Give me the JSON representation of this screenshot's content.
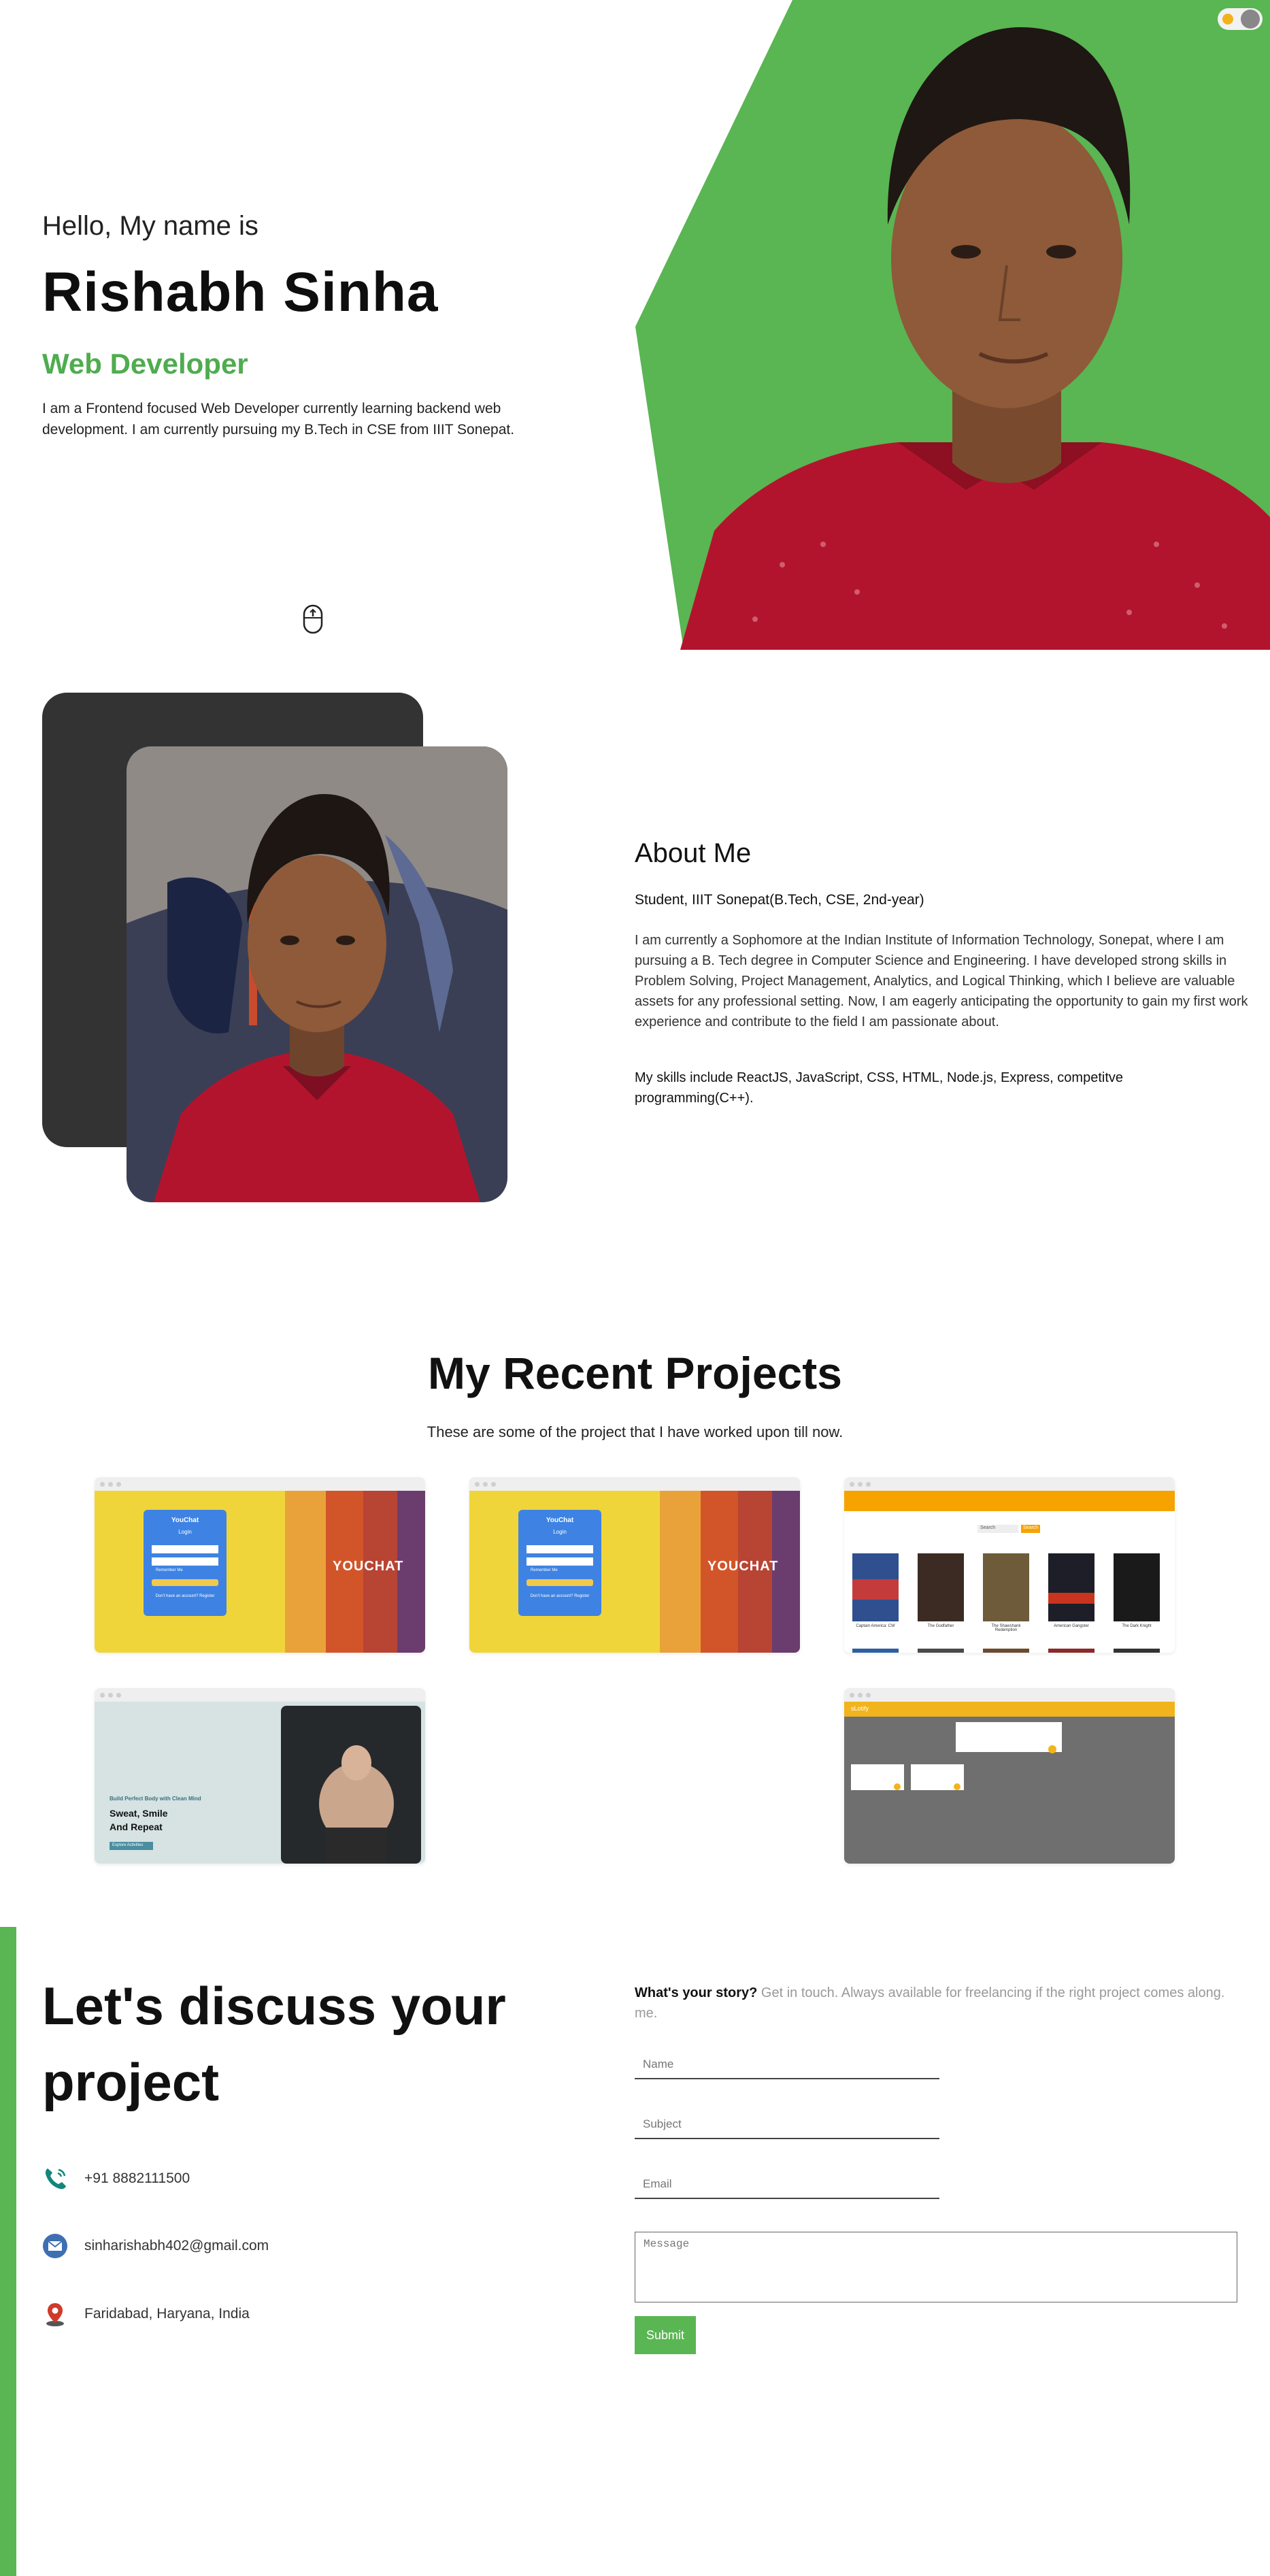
{
  "theme": {
    "accent": "#5ab553",
    "accent_text": "#4fac4f",
    "dark_card": "#333333"
  },
  "hero": {
    "greeting": "Hello, My name is",
    "name": "Rishabh Sinha",
    "role": "Web Developer",
    "bio": "I am a Frontend focused Web Developer currently learning backend web development. I am currently pursuing my B.Tech in CSE from IIIT Sonepat.",
    "photo_icon": "profile-photo",
    "scroll_icon": "mouse-scroll-icon",
    "theme_toggle_icon": "sun-moon-toggle-icon"
  },
  "about": {
    "title": "About Me",
    "subtitle": "Student, IIIT Sonepat(B.Tech, CSE, 2nd-year)",
    "paragraph": "I am currently a Sophomore at the Indian Institute of Information Technology, Sonepat, where I am pursuing a B. Tech degree in Computer Science and Engineering. I have developed strong skills in Problem Solving, Project Management, Analytics, and Logical Thinking, which I believe are valuable assets for any professional setting. Now, I am eagerly anticipating the opportunity to gain my first work experience and contribute to the field I am passionate about.",
    "skills": "My skills include ReactJS, JavaScript, CSS, HTML, Node.js, Express, competitve programming(C++)."
  },
  "projects": {
    "title": "My Recent Projects",
    "subtitle": "These are some of the project that I have worked upon till now.",
    "youchat": {
      "brand": "YouChat",
      "login": "Login",
      "remember": "Remember Me",
      "hero_word": "YOUCHAT",
      "footer": "Don't have an account? Register"
    },
    "movies": {
      "search_placeholder": "Search",
      "search_button": "Search",
      "cards": [
        "Captain America: CW",
        "The Godfather",
        "The Shawshank Redemption",
        "American Gangster",
        "The Dark Knight"
      ]
    },
    "gym": {
      "tagline": "Build Perfect Body with Clean Mind",
      "headline_1": "Sweat, Smile",
      "headline_2": "And Repeat",
      "cta": "Explore Activities"
    },
    "kanban": {
      "brand": "sLotify"
    }
  },
  "contact": {
    "title": "Let's discuss your project",
    "phone": "+91 8882111500",
    "email": "sinharishabh402@gmail.com",
    "location": "Faridabad, Haryana, India",
    "story_bold": "What's your story?",
    "story_text": " Get in touch. Always available for freelancing if the right project comes along. me.",
    "name_placeholder": "Name",
    "subject_placeholder": "Subject",
    "email_placeholder": "Email",
    "message_placeholder": "Message",
    "submit_label": "Submit"
  }
}
